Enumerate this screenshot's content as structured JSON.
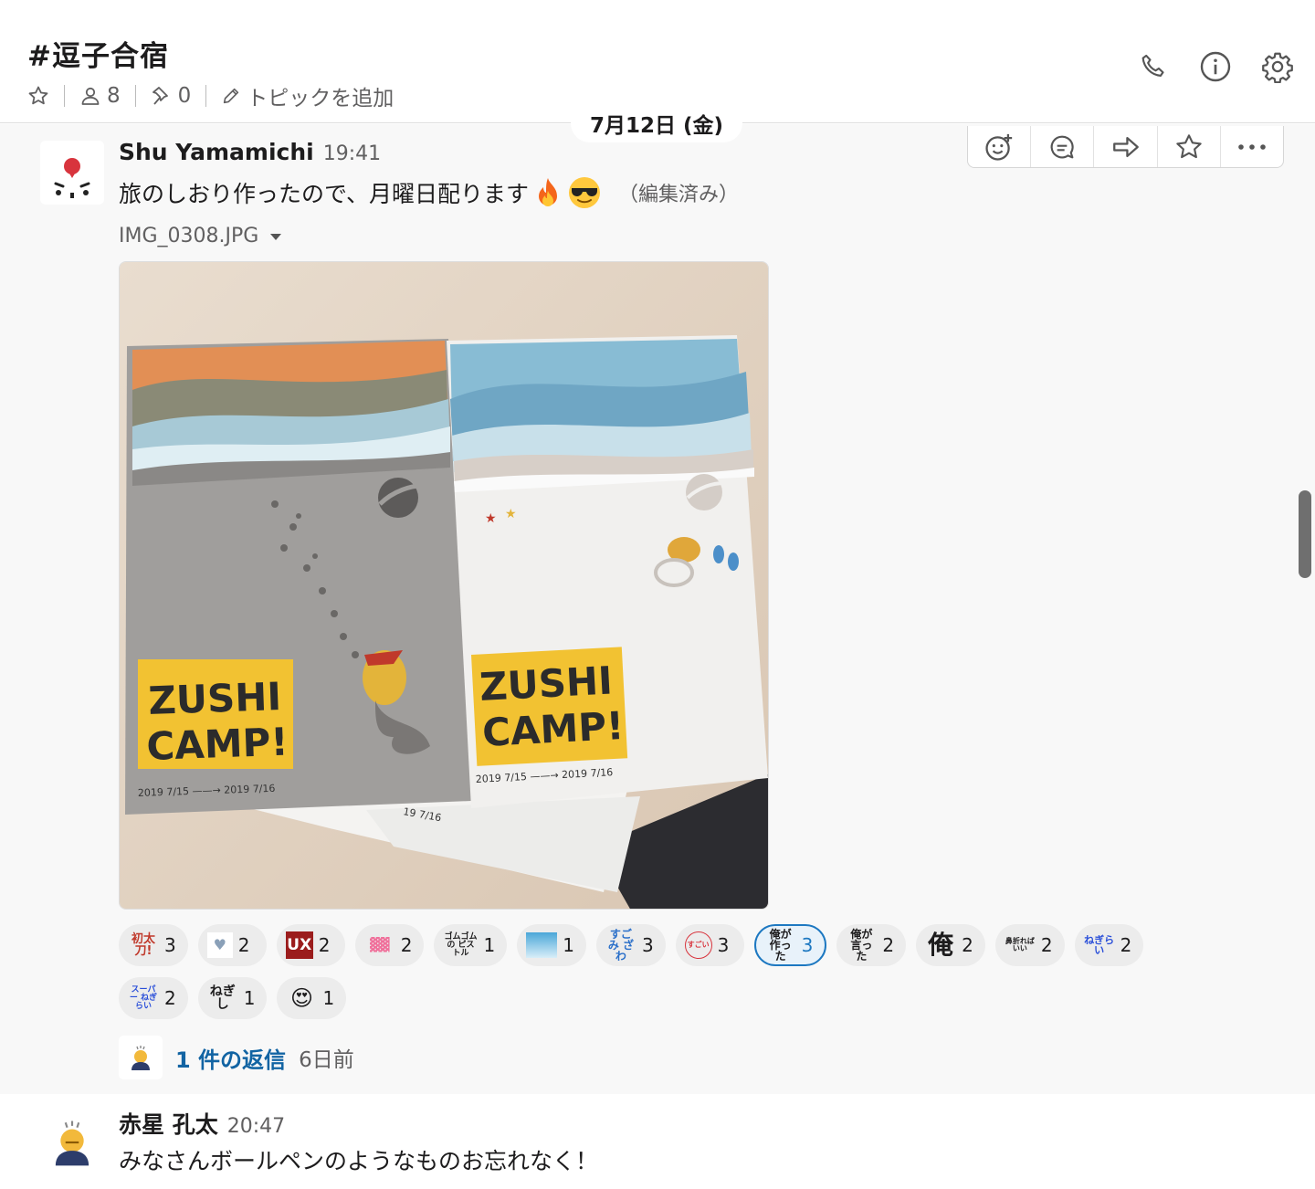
{
  "header": {
    "channel_name": "#逗子合宿",
    "members_count": "8",
    "pins_count": "0",
    "topic_label": "トピックを追加"
  },
  "date_divider": "7月12日 (金)",
  "message1": {
    "author": "Shu Yamamichi",
    "time": "19:41",
    "text": "旅のしおり作ったので、月曜日配ります",
    "edited": "（編集済み）",
    "file_name": "IMG_0308.JPG",
    "photo": {
      "left_title_line1": "ZUSHI",
      "left_title_line2": "CAMP!",
      "left_dates": "2019 7/15 ——→ 2019 7/16",
      "right_title_line1": "ZUSHI",
      "right_title_line2": "CAMP!",
      "right_dates": "2019 7/15 ——→ 2019 7/16",
      "under_date": "19 7/16"
    },
    "reactions": [
      {
        "icon": "初太刀!",
        "count": "3"
      },
      {
        "icon": "♥",
        "count": "2"
      },
      {
        "icon": "UX",
        "count": "2"
      },
      {
        "icon": "▓▓",
        "count": "2"
      },
      {
        "icon": "ゴムゴムの ピストル",
        "count": "1"
      },
      {
        "icon": "▤",
        "count": "1"
      },
      {
        "icon": "すごみ ざわ",
        "count": "3"
      },
      {
        "icon": "すごい",
        "count": "3"
      },
      {
        "icon": "俺が 作った",
        "count": "3"
      },
      {
        "icon": "俺が 言った",
        "count": "2"
      },
      {
        "icon": "俺",
        "count": "2"
      },
      {
        "icon": "鼻折れば いい",
        "count": "2"
      },
      {
        "icon": "ねぎらい",
        "count": "2"
      },
      {
        "icon": "スーパー ねぎらい",
        "count": "2"
      },
      {
        "icon": "ねぎし",
        "count": "1"
      },
      {
        "icon": "😍",
        "count": "1"
      }
    ],
    "thread": {
      "link": "1 件の返信",
      "time": "6日前"
    }
  },
  "message2": {
    "author": "赤星 孔太",
    "time": "20:47",
    "text": "みなさんボールペンのようなものお忘れなく！"
  },
  "colors": {
    "link": "#1264a3",
    "active_reaction": "#1d78c1",
    "hover_bg": "#f8f8f8",
    "poster_yellow": "#f2c232"
  }
}
